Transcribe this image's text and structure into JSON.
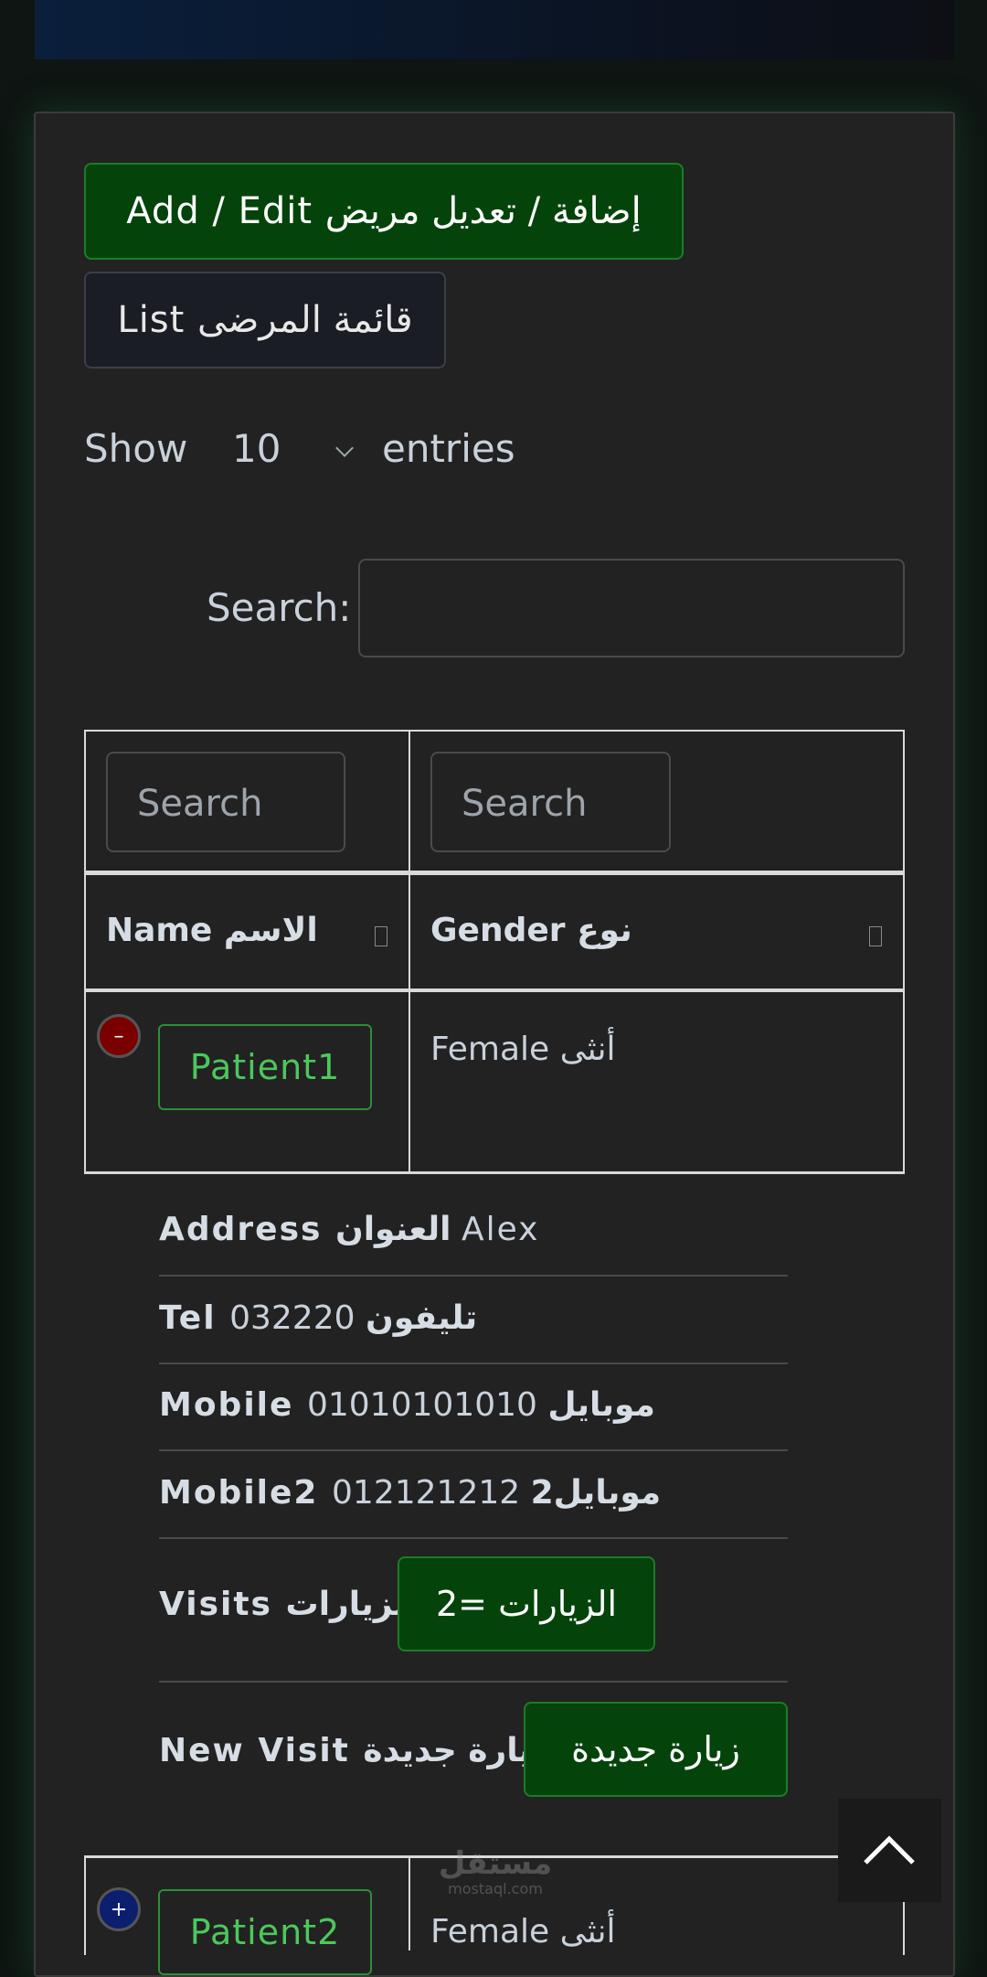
{
  "buttons": {
    "add_edit": "Add / Edit إضافة / تعديل مريض",
    "list": "List قائمة المرضى"
  },
  "length": {
    "show": "Show",
    "value": "10",
    "entries": "entries"
  },
  "search": {
    "label": "Search:",
    "value": ""
  },
  "filters": {
    "name_placeholder": "Search",
    "gender_placeholder": "Search"
  },
  "columns": {
    "name": "Name الاسم",
    "gender": "Gender نوع"
  },
  "rows": [
    {
      "name": "Patient1",
      "gender": "Female أنثى",
      "control": "–"
    },
    {
      "name": "Patient2",
      "gender": "Female أنثى",
      "control": "+"
    }
  ],
  "details": {
    "address_label": "Address العنوان",
    "address_value": "Alex",
    "tel_label": "Tel تليفون",
    "tel_value": "032220",
    "mobile_label": "Mobile موبايل",
    "mobile_value": "01010101010",
    "mobile2_label": "Mobile2 موبايل2",
    "mobile2_value": "012121212",
    "visits_label": "Visits الزيارات",
    "visits_button": "الزيارات =2",
    "new_visit_label": "New Visit زيارة جديدة",
    "new_visit_button": "زيارة جديدة"
  },
  "watermark": {
    "arabic": "مستقل",
    "latin": "mostaql.com"
  },
  "icons": {
    "scroll_top": "chevron-up-icon",
    "sort": "sort-icon"
  },
  "colors": {
    "primary_button": "#04440b",
    "link_green": "#4cc85c",
    "collapse_red": "#7a0000",
    "expand_blue": "#0c1f6e"
  }
}
